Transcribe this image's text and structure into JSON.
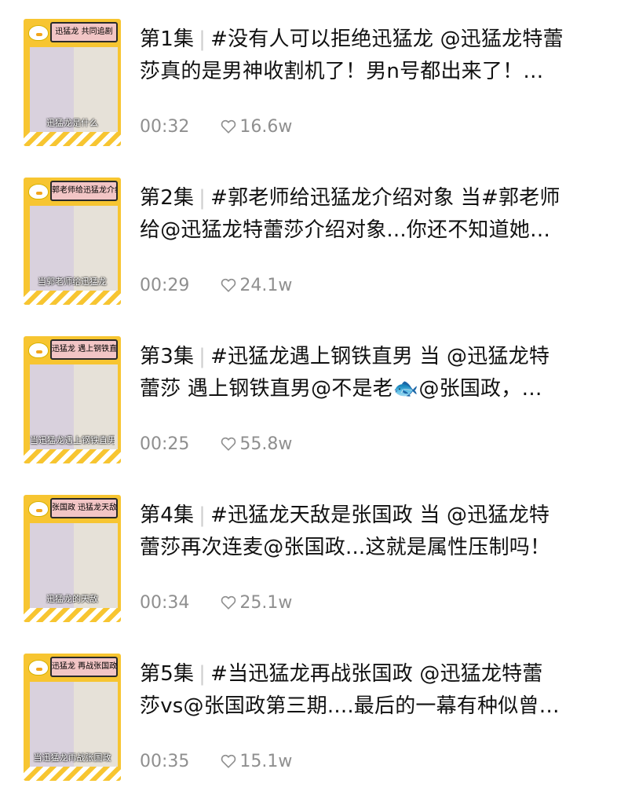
{
  "app": {
    "background": "#ffffff",
    "accent": "#f7c531"
  },
  "episodes": [
    {
      "label": "第1集",
      "line1": "#没有人可以拒绝迅猛龙 @迅猛龙特蕾",
      "line2": "莎真的是男神收割机了！男n号都出来了！…",
      "duration": "00:32",
      "likes": "16.6w",
      "thumb_badge": "迅猛龙 共同追剧",
      "thumb_caption": "迅猛龙是什么"
    },
    {
      "label": "第2集",
      "line1": "#郭老师给迅猛龙介绍对象 当#郭老师",
      "line2": "给@迅猛龙特蕾莎介绍对象...你还不知道她…",
      "duration": "00:29",
      "likes": "24.1w",
      "thumb_badge": "郭老师给迅猛龙介绍对象",
      "thumb_caption": "当郭老师给迅猛龙"
    },
    {
      "label": "第3集",
      "line1": "#迅猛龙遇上钢铁直男 当 @迅猛龙特",
      "line2": "蕾莎 遇上钢铁直男@不是老🐟@张国政，…",
      "duration": "00:25",
      "likes": "55.8w",
      "thumb_badge": "迅猛龙 遇上钢铁直男",
      "thumb_caption": "当迅猛龙遇上钢铁直男"
    },
    {
      "label": "第4集",
      "line1": "#迅猛龙天敌是张国政 当 @迅猛龙特",
      "line2": "蕾莎再次连麦@张国政...这就是属性压制吗！",
      "duration": "00:34",
      "likes": "25.1w",
      "thumb_badge": "张国政 迅猛龙天敌",
      "thumb_caption": "迅猛龙的天敌"
    },
    {
      "label": "第5集",
      "line1": "#当迅猛龙再战张国政 @迅猛龙特蕾",
      "line2": "莎vs@张国政第三期....最后的一幕有种似曾…",
      "duration": "00:35",
      "likes": "15.1w",
      "thumb_badge": "迅猛龙 再战张国政",
      "thumb_caption": "当迅猛龙再战张国政"
    }
  ]
}
